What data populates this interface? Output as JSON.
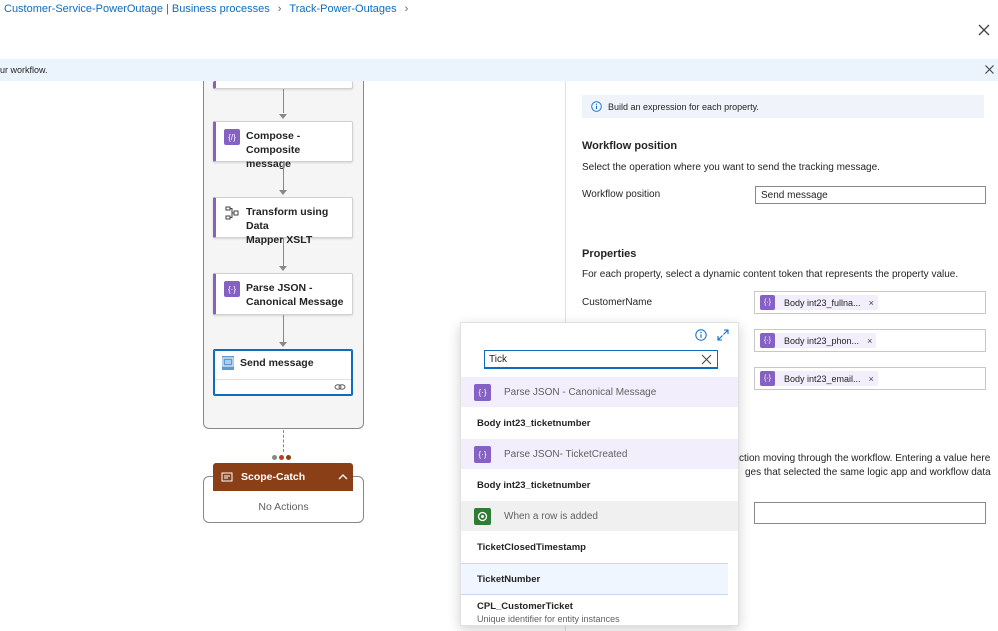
{
  "breadcrumb": {
    "items": [
      "Customer-Service-PowerOutage | Business processes",
      "Track-Power-Outages"
    ]
  },
  "infobar": {
    "text": "ur workflow."
  },
  "canvas": {
    "nodes": [
      {
        "label_line1": "Compose - Composite",
        "label_line2": "message",
        "icon": "compose-icon"
      },
      {
        "label_line1": "Transform using Data",
        "label_line2": "Mapper XSLT",
        "icon": "transform-icon"
      },
      {
        "label_line1": "Parse JSON -",
        "label_line2": "Canonical Message",
        "icon": "parse-json-icon"
      }
    ],
    "send_message": {
      "label": "Send message"
    },
    "scope_catch": {
      "label": "Scope-Catch",
      "empty_text": "No Actions"
    },
    "dots_colors": [
      "#8a8886",
      "#c0392b",
      "#8a3f17"
    ]
  },
  "panel": {
    "info_note": "Build an expression for each property.",
    "workflow_position": {
      "heading": "Workflow position",
      "description": "Select the operation where you want to send the tracking message.",
      "label": "Workflow position",
      "value": "Send message"
    },
    "properties": {
      "heading": "Properties",
      "description": "For each property, select a dynamic content token that represents the property value.",
      "label": "CustomerName",
      "tokens": [
        "Body int23_fullna...",
        "Body int23_phon...",
        "Body int23_email..."
      ],
      "token_remove": "×"
    },
    "tracking_text": {
      "line1": "ction moving through the workflow. Entering a value here",
      "line2": "ges that selected the same logic app and workflow data"
    }
  },
  "dropdown": {
    "search_value": "Tick",
    "groups": [
      {
        "name": "Parse JSON - Canonical Message",
        "items": [
          "Body int23_ticketnumber"
        ]
      },
      {
        "name": "Parse JSON- TicketCreated",
        "items": [
          "Body int23_ticketnumber"
        ]
      },
      {
        "name": "When a row is added",
        "items": [
          "TicketClosedTimestamp",
          "TicketNumber"
        ]
      }
    ],
    "last_item": {
      "title": "CPL_CustomerTicket",
      "subtitle": "Unique identifier for entity instances"
    }
  },
  "colors": {
    "accent": "#0f6cbd",
    "parse_json": "#8661c5",
    "scope_catch": "#8a3f17",
    "dataverse": "#2e7d32"
  }
}
